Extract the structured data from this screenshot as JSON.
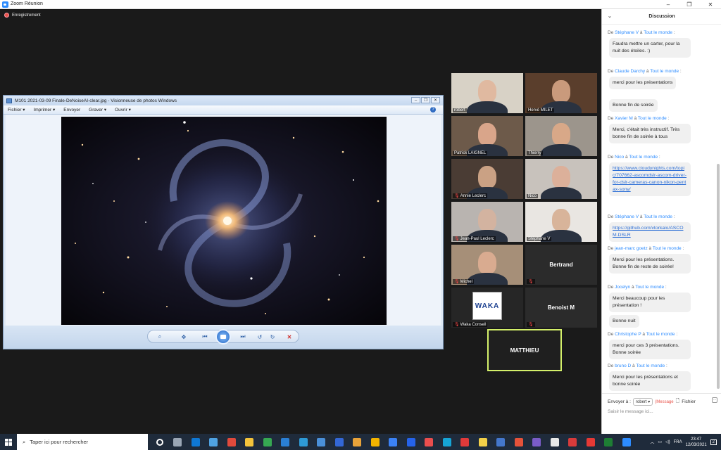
{
  "window": {
    "title": "Zoom Réunion",
    "controls": [
      "–",
      "❐",
      "✕"
    ]
  },
  "recording": {
    "label": "Enregistrement"
  },
  "viewer": {
    "title": "M101 2021-03-09 Finale-DeNoiseAI-clear.jpg - Visionneuse de photos Windows",
    "menu": [
      "Fichier ▾",
      "Imprimer ▾",
      "Envoyer",
      "Graver ▾",
      "Ouvrir ▾"
    ],
    "help": "?",
    "buttons": [
      "–",
      "❐",
      "✕"
    ]
  },
  "participants": [
    {
      "name": "robert",
      "muted": false,
      "video": true,
      "skin": "#e0b9a0",
      "bg": "#d8d2c6"
    },
    {
      "name": "Hervé MILET",
      "muted": false,
      "video": true,
      "skin": "#c99a7c",
      "bg": "#5a3e2c"
    },
    {
      "name": "Patrick LAIGNEL",
      "muted": false,
      "video": true,
      "skin": "#d9a58a",
      "bg": "#6d5a4a"
    },
    {
      "name": "Thierry",
      "muted": false,
      "video": true,
      "skin": "#d8a888",
      "bg": "#9c958c"
    },
    {
      "name": "Annie Leclerc",
      "muted": true,
      "video": true,
      "skin": "#caa184",
      "bg": "#4a3c34"
    },
    {
      "name": "Nico",
      "muted": false,
      "video": true,
      "skin": "#dcb09a",
      "bg": "#c8c2bc"
    },
    {
      "name": "Jean-Paul Leclerc",
      "muted": true,
      "video": true,
      "skin": "#d3b3a0",
      "bg": "#b9b4b0"
    },
    {
      "name": "Stéphane V",
      "muted": false,
      "video": true,
      "skin": "#d8b49a",
      "bg": "#e9e6e2"
    },
    {
      "name": "Michel",
      "muted": true,
      "video": true,
      "skin": "#d9ab90",
      "bg": "#a68f78"
    },
    {
      "name": "Bertrand",
      "muted": true,
      "video": false
    },
    {
      "name": "Waka Conseil",
      "muted": true,
      "video": false,
      "logo": "WAKA"
    },
    {
      "name": "Benoist M",
      "muted": true,
      "video": false
    },
    {
      "name": "MATTHIEU",
      "muted": false,
      "video": false,
      "active": true
    }
  ],
  "chat": {
    "title": "Discussion",
    "messages": [
      {
        "from_prefix": "De",
        "from": "Stéphane V",
        "to_prefix": "à",
        "to": "Tout le monde",
        "suffix": ":",
        "bubbles": [
          "Faudra mettre un carter, pour la nuit des étoiles. :)"
        ]
      },
      {
        "from_prefix": "De",
        "from": "Claude Darchy",
        "to_prefix": "à",
        "to": "Tout le monde",
        "suffix": ":",
        "bubbles": [
          "merci pour les présentations",
          "Bonne fin de soirée"
        ]
      },
      {
        "from_prefix": "De",
        "from": "Xavier M",
        "to_prefix": "à",
        "to": "Tout le monde",
        "suffix": ":",
        "bubbles": [
          "Merci, c'était très instructif. Très bonne fin de soirée à tous"
        ]
      },
      {
        "from_prefix": "De",
        "from": "Nico",
        "to_prefix": "à",
        "to": "Tout le monde",
        "suffix": ":",
        "link": "https://www.cloudynights.com/topic/707662-ascomdslr-ascom-driver-for-dslr-cameras-canon-nikon-pentax-sony/"
      },
      {
        "from_prefix": "De",
        "from": "Stéphane V",
        "to_prefix": "à",
        "to": "Tout le monde",
        "suffix": ":",
        "link": "https://github.com/vtorkalo/ASCOM.DSLR"
      },
      {
        "from_prefix": "De",
        "from": "jean-marc goetz",
        "to_prefix": "à",
        "to": "Tout le monde",
        "suffix": ":",
        "bubbles": [
          "Merci pour les présentations. Bonne fin de reste de soirée!"
        ]
      },
      {
        "from_prefix": "De",
        "from": "Jocelyn",
        "to_prefix": "à",
        "to": "Tout le monde",
        "suffix": ":",
        "bubbles": [
          "Merci beaucoup pour les présentation !",
          "Bonne nuit"
        ]
      },
      {
        "from_prefix": "De",
        "from": "Christophe P",
        "to_prefix": "à",
        "to": "Tout le monde",
        "suffix": ":",
        "bubbles": [
          "merci  pour ces 3 présentations.  Bonne soirée"
        ]
      },
      {
        "from_prefix": "De",
        "from": "bruno D",
        "to_prefix": "à",
        "to": "Tout le monde",
        "suffix": ":",
        "bubbles": [
          "Merci pour les présentations et bonne soirée"
        ]
      }
    ],
    "send_to_label": "Envoyer à :",
    "send_to_value": "robert ▾",
    "message_label": "(Message",
    "file_label": "Fichier",
    "input_placeholder": "Saisir le message ici..."
  },
  "taskbar": {
    "search_placeholder": "Taper ici pour rechercher",
    "language": "FRA",
    "time": "23:47",
    "date": "12/03/2021",
    "notification_count": "2",
    "app_colors": [
      "#ffffff",
      "#9aa6b5",
      "#0f78d4",
      "#4fa3e3",
      "#e04a3c",
      "#f3c33b",
      "#36a852",
      "#2a7fd4",
      "#2e9ad6",
      "#4a90d9",
      "#3367d6",
      "#e8a33a",
      "#f2b300",
      "#3b82f6",
      "#2563eb",
      "#e94e4e",
      "#16a5d6",
      "#e03a3a",
      "#f2d049",
      "#4477cc",
      "#e5523a",
      "#7a5cc7",
      "#e8e8e8",
      "#d83b3b",
      "#e53935",
      "#1e7e34",
      "#2d8cff"
    ]
  }
}
